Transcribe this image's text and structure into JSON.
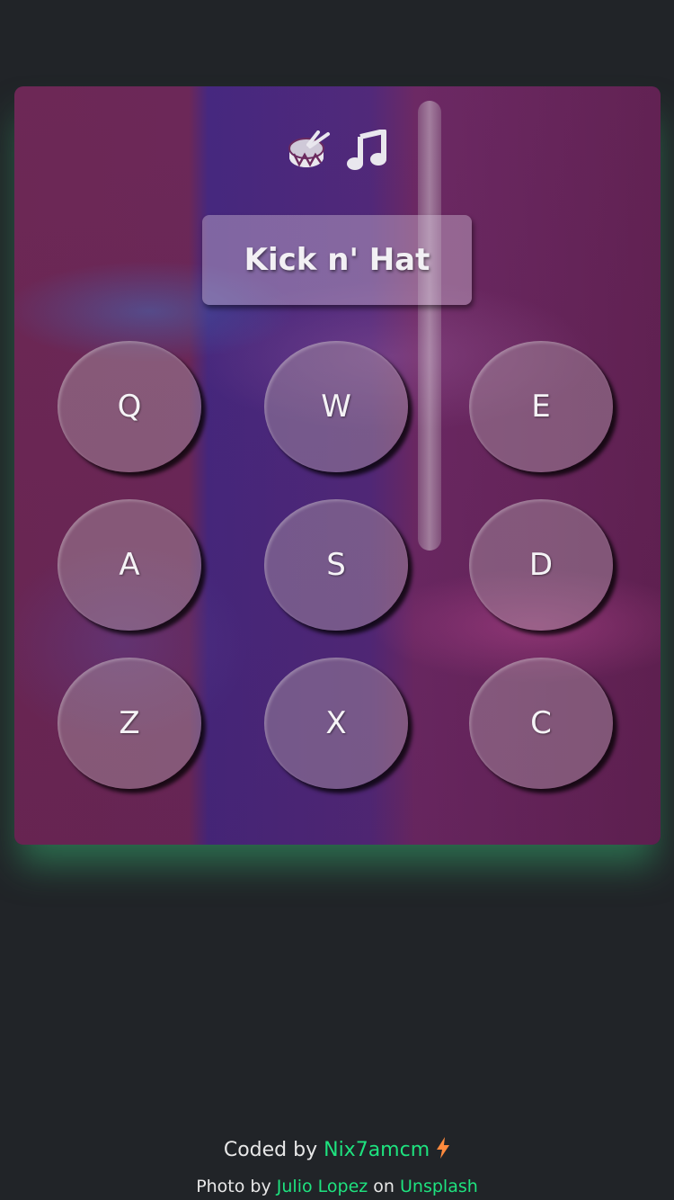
{
  "colors": {
    "page_background": "#212428",
    "accent_link": "#1ee37f",
    "bolt": "#ff8a3d",
    "glow": "#2f9e66"
  },
  "header_icons": [
    {
      "name": "drum-icon"
    },
    {
      "name": "music-icon"
    }
  ],
  "display": {
    "text": "Kick n' Hat"
  },
  "pads": [
    {
      "key": "Q"
    },
    {
      "key": "W"
    },
    {
      "key": "E"
    },
    {
      "key": "A"
    },
    {
      "key": "S"
    },
    {
      "key": "D"
    },
    {
      "key": "Z"
    },
    {
      "key": "X"
    },
    {
      "key": "C"
    }
  ],
  "footer": {
    "coded_by": "Coded by",
    "author": "Nix7amcm",
    "photo_by": "Photo by",
    "photographer": "Julio Lopez",
    "on": "on",
    "site": "Unsplash"
  }
}
